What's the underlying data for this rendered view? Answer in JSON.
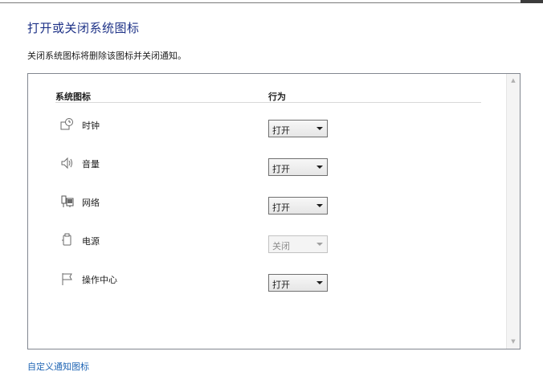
{
  "page": {
    "title": "打开或关闭系统图标",
    "description": "关闭系统图标将删除该图标并关闭通知。",
    "footer_link": "自定义通知图标"
  },
  "table": {
    "col_system": "系统图标",
    "col_behavior": "行为",
    "rows": [
      {
        "icon": "clock-icon",
        "label": "时钟",
        "value": "打开",
        "enabled": true
      },
      {
        "icon": "volume-icon",
        "label": "音量",
        "value": "打开",
        "enabled": true
      },
      {
        "icon": "network-icon",
        "label": "网络",
        "value": "打开",
        "enabled": true
      },
      {
        "icon": "power-icon",
        "label": "电源",
        "value": "关闭",
        "enabled": false
      },
      {
        "icon": "flag-icon",
        "label": "操作中心",
        "value": "打开",
        "enabled": true
      }
    ]
  }
}
